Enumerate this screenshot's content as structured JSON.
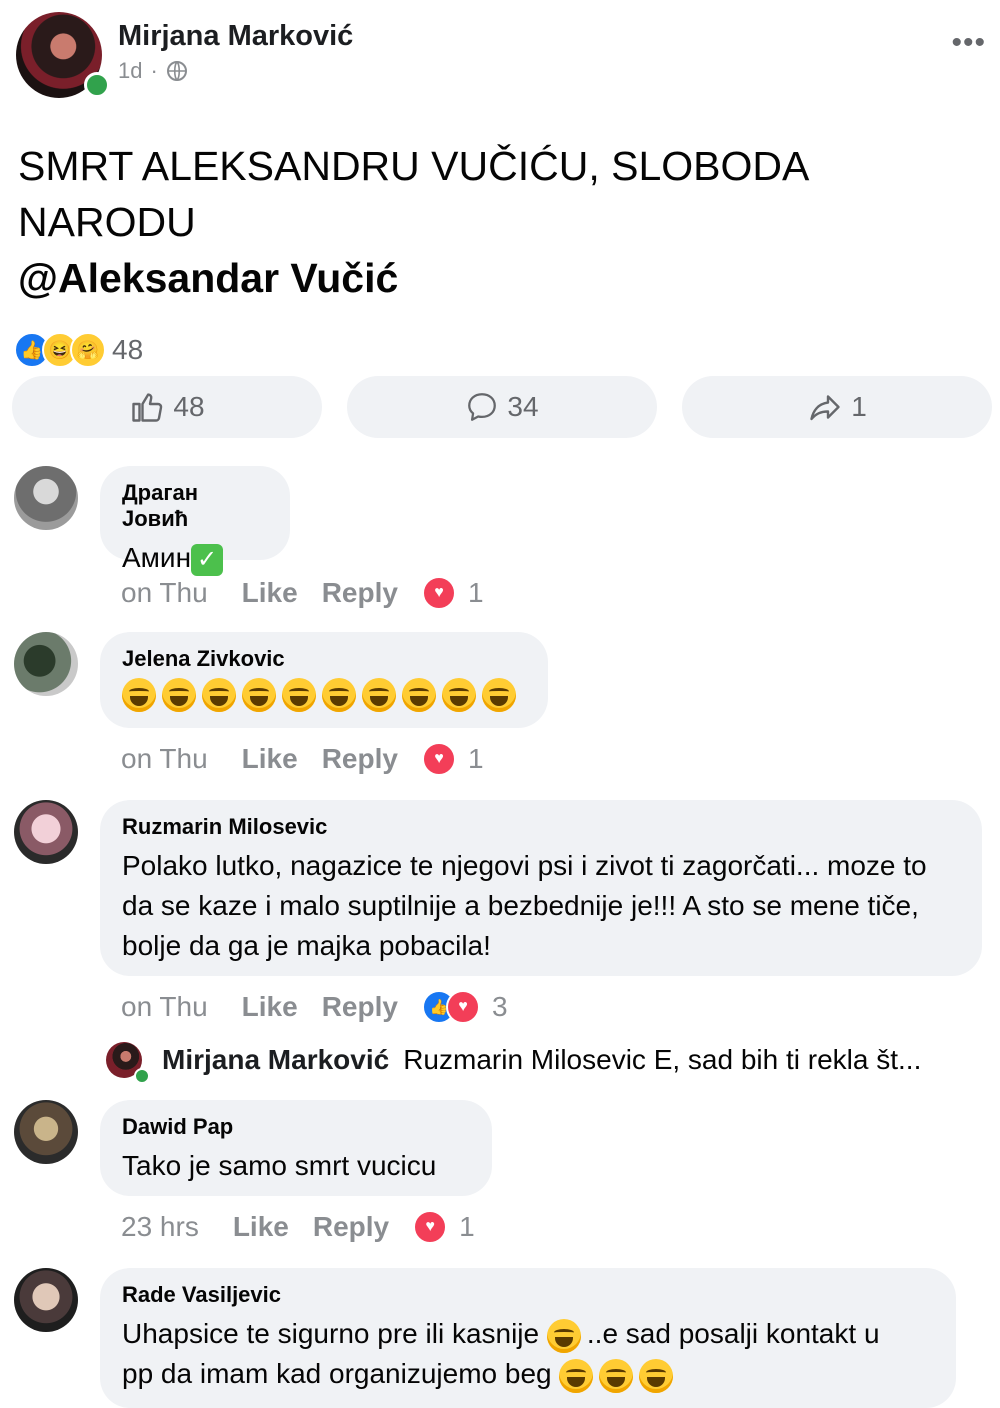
{
  "post": {
    "author": "Mirjana Marković",
    "time": "1d",
    "separator": "·",
    "text_line1": "SMRT ALEKSANDRU VUČIĆU, SLOBODA",
    "text_line2": "NARODU",
    "mention": "@Aleksandar Vučić",
    "reaction_count": "48",
    "like_count": "48",
    "comment_count": "34",
    "share_count": "1",
    "more_label": "•••"
  },
  "comments": [
    {
      "name": "Драган Јовић",
      "text": "Амин",
      "time": "on Thu",
      "like": "Like",
      "reply": "Reply",
      "reactions": "1"
    },
    {
      "name": "Jelena Zivkovic",
      "time": "on Thu",
      "like": "Like",
      "reply": "Reply",
      "reactions": "1"
    },
    {
      "name": "Ruzmarin Milosevic",
      "text": "Polako lutko, nagazice te njegovi psi i zivot ti zagorčati... moze to da se kaze i malo suptilnije a bezbednije je!!! A sto se mene tiče, bolje da ga je majka pobacila!",
      "time": "on Thu",
      "like": "Like",
      "reply": "Reply",
      "reactions": "3"
    },
    {
      "name": "Dawid Pap",
      "text": "Tako je samo smrt vucicu",
      "time": "23 hrs",
      "like": "Like",
      "reply": "Reply",
      "reactions": "1"
    },
    {
      "name": "Rade Vasiljevic",
      "text_a": "Uhapsice te sigurno pre ili kasnije",
      "text_b": "..e sad posalji kontakt u",
      "text_c": "pp da imam kad organizujemo beg"
    }
  ],
  "reply_preview": {
    "name": "Mirjana Marković",
    "text": "Ruzmarin Milosevic E, sad bih ti rekla št..."
  },
  "colors": {
    "accent": "#1877f2",
    "heart": "#f33e58",
    "bubble": "#f0f2f5",
    "online": "#31a24c"
  }
}
